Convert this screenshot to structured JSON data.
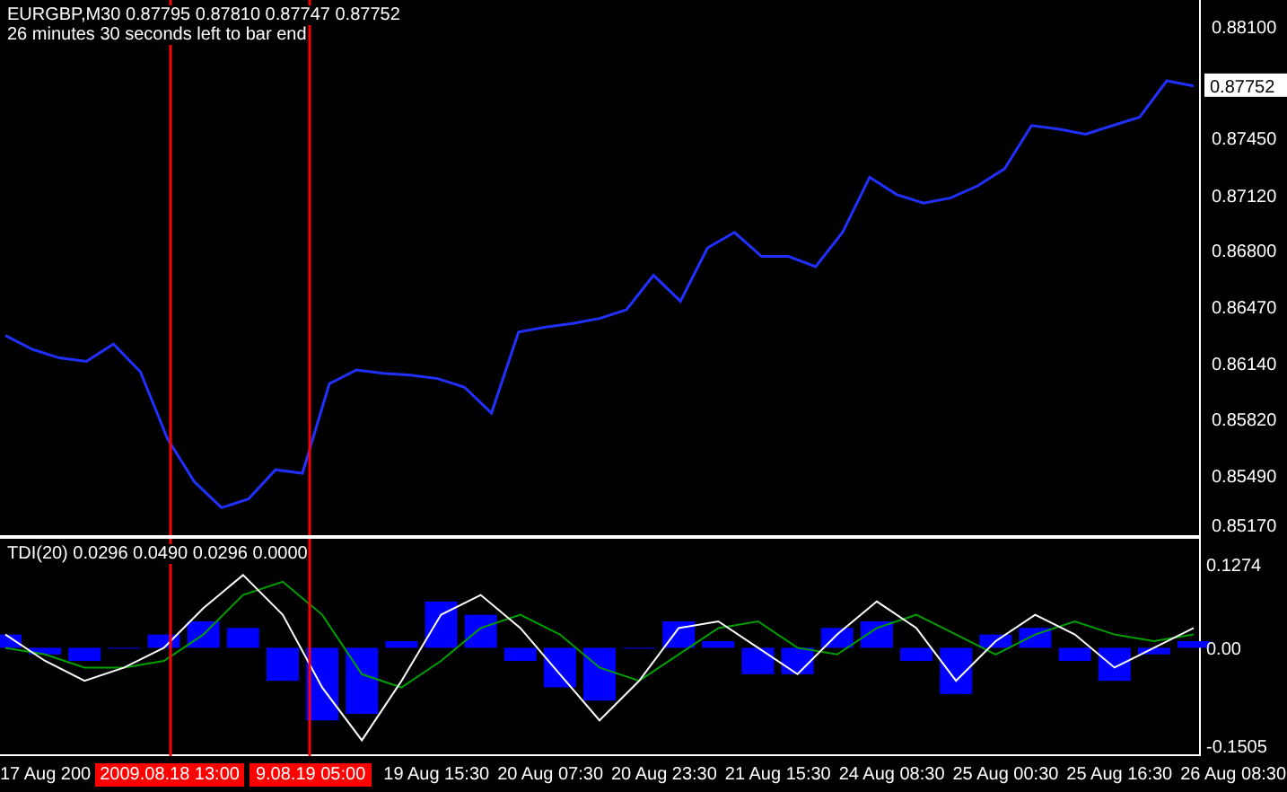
{
  "header": {
    "symbol_line": "EURGBP,M30  0.87795 0.87810 0.87747 0.87752",
    "countdown": "26 minutes 30 seconds left to bar end"
  },
  "price_chart": {
    "current_price": "0.87752",
    "chart_data": {
      "type": "line",
      "ylim": [
        0.8514,
        0.8825
      ],
      "yticks": [
        {
          "value": 0.881,
          "label": "0.88100"
        },
        {
          "value": 0.8745,
          "label": "0.87450"
        },
        {
          "value": 0.8712,
          "label": "0.87120"
        },
        {
          "value": 0.868,
          "label": "0.86800"
        },
        {
          "value": 0.8647,
          "label": "0.86470"
        },
        {
          "value": 0.8614,
          "label": "0.86140"
        },
        {
          "value": 0.8582,
          "label": "0.85820"
        },
        {
          "value": 0.8549,
          "label": "0.85490"
        },
        {
          "value": 0.8517,
          "label": "0.85170"
        }
      ],
      "series": [
        {
          "color": "#2030ff",
          "values": [
            0.863,
            0.8622,
            0.8617,
            0.8615,
            0.8625,
            0.8609,
            0.857,
            0.8545,
            0.853,
            0.8535,
            0.8552,
            0.855,
            0.8602,
            0.861,
            0.8608,
            0.8607,
            0.8605,
            0.86,
            0.8585,
            0.8632,
            0.8635,
            0.8637,
            0.864,
            0.8645,
            0.8665,
            0.865,
            0.8681,
            0.869,
            0.8676,
            0.8676,
            0.867,
            0.869,
            0.8722,
            0.8712,
            0.8707,
            0.871,
            0.8717,
            0.8727,
            0.8752,
            0.875,
            0.8747,
            0.8752,
            0.8757,
            0.8778,
            0.8775
          ]
        }
      ]
    }
  },
  "indicator": {
    "legend": "TDI(20) 0.0296 0.0490 0.0296 0.0000",
    "chart_data": {
      "type": "line",
      "ylim": [
        -0.164,
        0.165
      ],
      "yticks": [
        {
          "value": 0.1274,
          "label": "0.1274"
        },
        {
          "value": 0,
          "label": "0.00"
        },
        {
          "value": -0.1505,
          "label": "-0.1505"
        }
      ],
      "series": [
        {
          "type": "bar",
          "color": "#0000ff",
          "values": [
            0.02,
            -0.01,
            -0.02,
            0,
            0.02,
            0.04,
            0.03,
            -0.05,
            -0.11,
            -0.1,
            0.01,
            0.07,
            0.05,
            -0.02,
            -0.06,
            -0.08,
            0,
            0.04,
            0.01,
            -0.04,
            -0.04,
            0.03,
            0.04,
            -0.02,
            -0.07,
            0.02,
            0.03,
            -0.02,
            -0.05,
            -0.01,
            0.01
          ]
        },
        {
          "color": "#00a000",
          "values": [
            0.0,
            -0.01,
            -0.03,
            -0.03,
            -0.02,
            0.02,
            0.08,
            0.1,
            0.05,
            -0.04,
            -0.06,
            -0.02,
            0.03,
            0.05,
            0.02,
            -0.03,
            -0.05,
            -0.01,
            0.03,
            0.04,
            0.0,
            -0.01,
            0.03,
            0.05,
            0.02,
            -0.01,
            0.02,
            0.04,
            0.02,
            0.01,
            0.02
          ]
        },
        {
          "color": "#ffffff",
          "values": [
            0.02,
            -0.02,
            -0.05,
            -0.03,
            0.0,
            0.06,
            0.11,
            0.05,
            -0.06,
            -0.14,
            -0.05,
            0.05,
            0.08,
            0.03,
            -0.04,
            -0.11,
            -0.05,
            0.03,
            0.04,
            0.0,
            -0.04,
            0.02,
            0.07,
            0.03,
            -0.05,
            0.01,
            0.05,
            0.02,
            -0.03,
            0.0,
            0.03
          ]
        }
      ]
    }
  },
  "time_axis": {
    "labels": [
      {
        "text": "17 Aug 200",
        "highlighted": false
      },
      {
        "text": "2009.08.18 13:00",
        "highlighted": true
      },
      {
        "text": "9.08.19 05:00",
        "highlighted": true
      },
      {
        "text": "19 Aug 15:30",
        "highlighted": false
      },
      {
        "text": "20 Aug 07:30",
        "highlighted": false
      },
      {
        "text": "20 Aug 23:30",
        "highlighted": false
      },
      {
        "text": "21 Aug 15:30",
        "highlighted": false
      },
      {
        "text": "24 Aug 08:30",
        "highlighted": false
      },
      {
        "text": "25 Aug 00:30",
        "highlighted": false
      },
      {
        "text": "25 Aug 16:30",
        "highlighted": false
      },
      {
        "text": "26 Aug 08:30",
        "highlighted": false
      }
    ]
  }
}
